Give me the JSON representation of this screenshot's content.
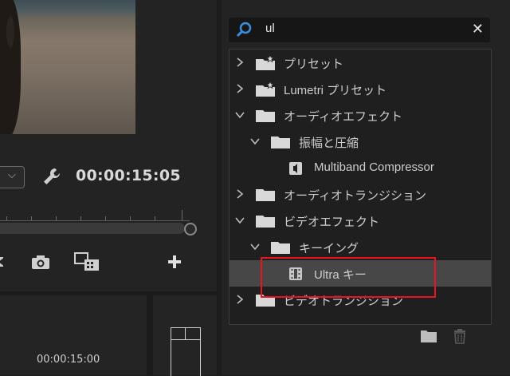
{
  "monitor": {
    "timecode": "00:00:15:05",
    "dropdown_icon": "chevron-down-icon",
    "settings_icon": "wrench-icon"
  },
  "toolbar": {
    "icons": [
      "step-back-icon",
      "camera-icon",
      "compare-icon",
      "add-icon"
    ]
  },
  "timeline": {
    "timecode": "00:00:15:00"
  },
  "effects": {
    "search": {
      "value": "ul",
      "icon": "search-icon",
      "clear_icon": "close-icon"
    },
    "items": [
      {
        "label": "プリセット",
        "level": 0,
        "expanded": false,
        "icon": "preset-folder-icon"
      },
      {
        "label": "Lumetri プリセット",
        "level": 0,
        "expanded": false,
        "icon": "preset-folder-icon"
      },
      {
        "label": "オーディオエフェクト",
        "level": 0,
        "expanded": true,
        "icon": "folder-icon"
      },
      {
        "label": "振幅と圧縮",
        "level": 1,
        "expanded": true,
        "icon": "folder-icon"
      },
      {
        "label": "Multiband Compressor",
        "level": 2,
        "icon": "audio-effect-icon"
      },
      {
        "label": "オーディオトランジション",
        "level": 0,
        "expanded": false,
        "icon": "folder-icon"
      },
      {
        "label": "ビデオエフェクト",
        "level": 0,
        "expanded": true,
        "icon": "folder-icon"
      },
      {
        "label": "キーイング",
        "level": 1,
        "expanded": true,
        "icon": "folder-icon"
      },
      {
        "label": "Ultra キー",
        "level": 2,
        "icon": "video-effect-icon",
        "selected": true
      },
      {
        "label": "ビデオトランジション",
        "level": 0,
        "expanded": false,
        "icon": "folder-icon"
      }
    ],
    "footer_icons": [
      "new-bin-icon",
      "trash-icon"
    ],
    "highlight_color": "#e8141e"
  }
}
